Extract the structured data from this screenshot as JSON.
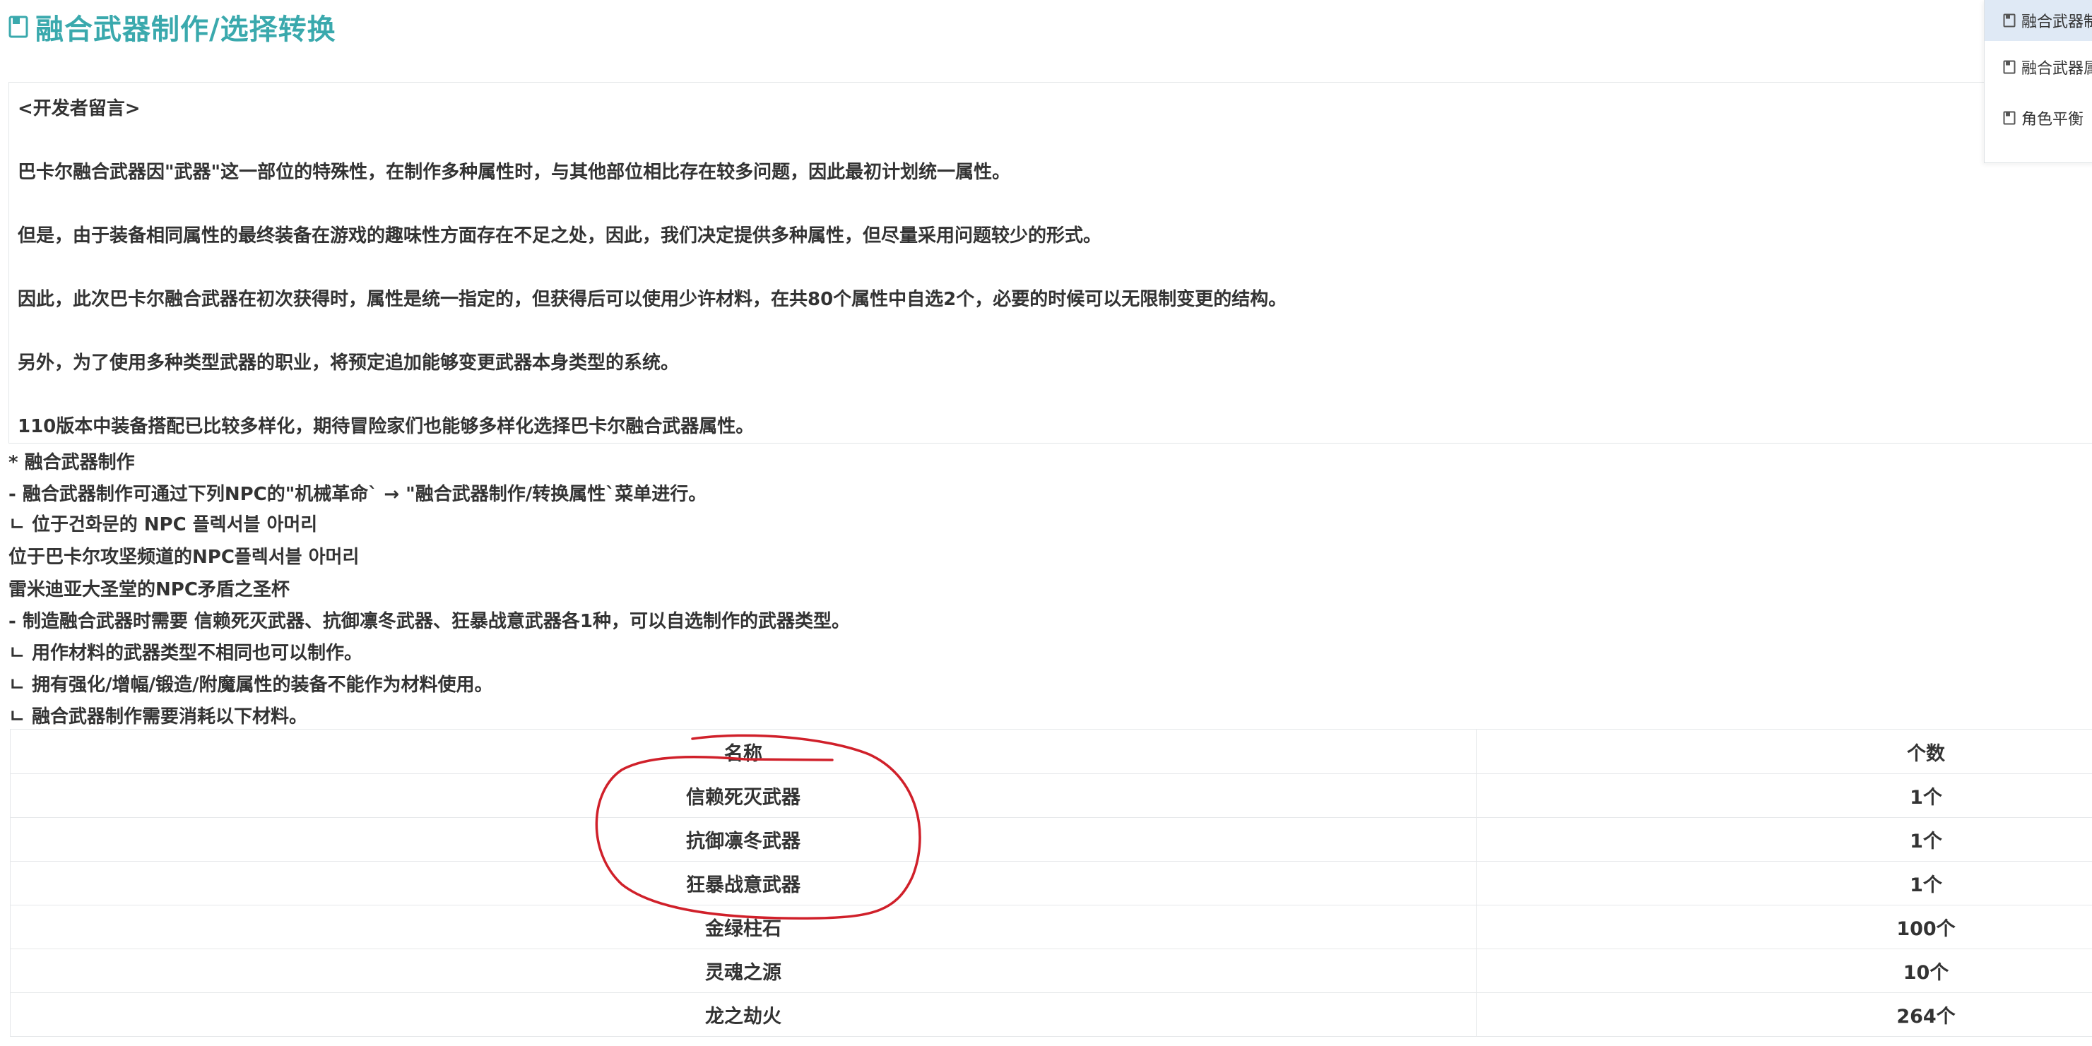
{
  "page_title": "融合武器制作/选择转换",
  "developer_note": {
    "heading": "<开发者留言>",
    "paragraphs": [
      "巴卡尔融合武器因\"武器\"这一部位的特殊性，在制作多种属性时，与其他部位相比存在较多问题，因此最初计划统一属性。",
      "但是，由于装备相同属性的最终装备在游戏的趣味性方面存在不足之处，因此，我们决定提供多种属性，但尽量采用问题较少的形式。",
      "因此，此次巴卡尔融合武器在初次获得时，属性是统一指定的，但获得后可以使用少许材料，在共80个属性中自选2个，必要的时候可以无限制变更的结构。",
      "另外，为了使用多种类型武器的职业，将预定追加能够变更武器本身类型的系统。",
      "110版本中装备搭配已比较多样化，期待冒险家们也能够多样化选择巴卡尔融合武器属性。"
    ]
  },
  "body_lines": [
    "* 融合武器制作",
    "- 融合武器制作可通过下列NPC的\"机械革命` → \"融合武器制作/转换属性`菜单进行。",
    "ㄴ 位于건화문的 NPC 플렉서블 아머리",
    "位于巴卡尔攻坚频道的NPC플렉서블 아머리",
    "雷米迪亚大圣堂的NPC矛盾之圣杯",
    "- 制造融合武器时需要 信赖死灭武器、抗御凛冬武器、狂暴战意武器各1种，可以自选制作的武器类型。",
    "ㄴ 用作材料的武器类型不相同也可以制作。",
    "ㄴ 拥有强化/增幅/锻造/附魔属性的装备不能作为材料使用。",
    "ㄴ 融合武器制作需要消耗以下材料。"
  ],
  "materials_table": {
    "headers": [
      "名称",
      "个数"
    ],
    "rows": [
      [
        "信赖死灭武器",
        "1个"
      ],
      [
        "抗御凛冬武器",
        "1个"
      ],
      [
        "狂暴战意武器",
        "1个"
      ],
      [
        "金绿柱石",
        "100个"
      ],
      [
        "灵魂之源",
        "10个"
      ],
      [
        "龙之劫火",
        "264个"
      ]
    ]
  },
  "side_panel": {
    "items": [
      "融合武器制作/选择转换",
      "融合武器属性",
      "角色平衡"
    ]
  },
  "colors": {
    "title": "#3aa9ad",
    "annotation": "#d0202a",
    "side_active": "#dfe9f5"
  }
}
